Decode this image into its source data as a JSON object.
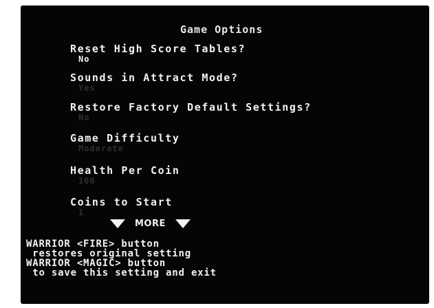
{
  "title": "Game Options",
  "options": [
    {
      "label": "Reset High Score Tables?",
      "value": "No"
    },
    {
      "label": "Sounds in Attract Mode?",
      "value": "Yes"
    },
    {
      "label": "Restore Factory Default Settings?",
      "value": "No"
    },
    {
      "label": "Game Difficulty",
      "value": "Moderate"
    },
    {
      "label": "Health Per Coin",
      "value": "100"
    },
    {
      "label": "Coins to Start",
      "value": "1"
    }
  ],
  "selected_option_index": 0,
  "more_label": "MORE",
  "help_lines": [
    "WARRIOR <FIRE> button",
    " restores original setting",
    "WARRIOR <MAGIC> button",
    " to save this setting and exit"
  ],
  "colors": {
    "screen_background": "#050505",
    "text": "#f2f2f2",
    "unselected_value": "#2e2e2e",
    "page_background": "#ffffff"
  },
  "icons": [
    "down-triangle-icon",
    "down-triangle-icon"
  ]
}
